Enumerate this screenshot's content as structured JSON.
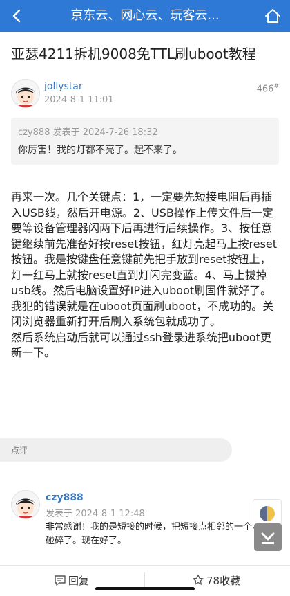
{
  "nav": {
    "title": "京东云、网心云、玩客云..."
  },
  "thread": {
    "title": "亚瑟4211拆机9008免TTL刷uboot教程"
  },
  "post": {
    "author": "jollystar",
    "time": "2024-8-1 11:01",
    "views": "466",
    "floor_mark": "#",
    "quote": {
      "meta": "czy888 发表于 2024-7-26 18:32",
      "text": "你厉害！我的灯都不亮了。起不来了。"
    },
    "paragraphs": [
      "再来一次。几个关键点：1，一定要先短接电阻后再插入USB线，然后开电源。2、USB操作上传文件后一定要等设备管理器闪两下后再进行后续操作。3、按任意键继续前先准备好按reset按钮，红灯亮起马上按reset按钮。我是按键盘任意键前先把手放到reset按钮上，灯一红马上就按reset直到灯闪完变蓝。4、马上拔掉usb线。然后电脑设置好IP进入uboot刷固件就好了。",
      "我犯的错误就是在uboot页面刷uboot，不成功的。关闭浏览器重新打开后刷入系统包就成功了。",
      "然后系统启动后就可以通过ssh登录进系统把uboot更新一下。"
    ]
  },
  "section": {
    "label": "点评"
  },
  "reply": {
    "author": "czy888",
    "time": "发表于 2024-8-1 12:48",
    "text": "非常感谢！我的是短接的时候，把短接点相邻的一个电阻碰碎了。现在好了。"
  },
  "bottom": {
    "reply_label": "回复",
    "fav_label": "78收藏"
  },
  "colors": {
    "brand": "#2f79d6",
    "link": "#3a78c2"
  }
}
